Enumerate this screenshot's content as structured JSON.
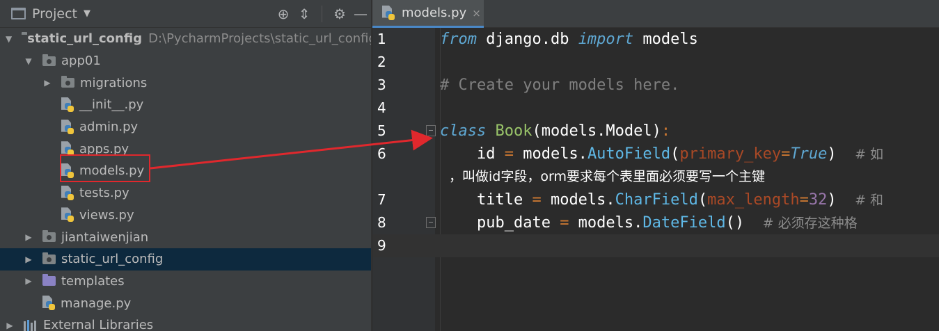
{
  "project_panel": {
    "title": "Project",
    "tree": [
      {
        "label": "static_url_config",
        "path": "D:\\PycharmProjects\\static_url_config",
        "indent": 0,
        "expanded": true,
        "type": "folder"
      },
      {
        "label": "app01",
        "indent": 1,
        "expanded": true,
        "type": "package"
      },
      {
        "label": "migrations",
        "indent": 2,
        "expanded": false,
        "type": "package"
      },
      {
        "label": "__init__.py",
        "indent": 2,
        "type": "pyfile"
      },
      {
        "label": "admin.py",
        "indent": 2,
        "type": "pyfile"
      },
      {
        "label": "apps.py",
        "indent": 2,
        "type": "pyfile"
      },
      {
        "label": "models.py",
        "indent": 2,
        "type": "pyfile",
        "highlighted": true
      },
      {
        "label": "tests.py",
        "indent": 2,
        "type": "pyfile"
      },
      {
        "label": "views.py",
        "indent": 2,
        "type": "pyfile"
      },
      {
        "label": "jiantaiwenjian",
        "indent": 1,
        "expanded": false,
        "type": "package"
      },
      {
        "label": "static_url_config",
        "indent": 1,
        "expanded": false,
        "type": "package",
        "selected": true
      },
      {
        "label": "templates",
        "indent": 1,
        "expanded": false,
        "type": "template-folder"
      },
      {
        "label": "manage.py",
        "indent": 1,
        "type": "pyfile"
      },
      {
        "label": "External Libraries",
        "indent": 0,
        "expanded": false,
        "type": "libraries"
      }
    ]
  },
  "editor": {
    "tab_label": "models.py",
    "tab_close": "×",
    "lines": [
      {
        "num": "1",
        "tokens": [
          [
            "kwi",
            "from"
          ],
          [
            "txt",
            " django.db "
          ],
          [
            "kwi",
            "import"
          ],
          [
            "txt",
            " models"
          ]
        ]
      },
      {
        "num": "2",
        "tokens": []
      },
      {
        "num": "3",
        "tokens": [
          [
            "cmt",
            "# Create your models here."
          ]
        ]
      },
      {
        "num": "4",
        "tokens": []
      },
      {
        "num": "5",
        "fold": true,
        "tokens": [
          [
            "kwi",
            "class"
          ],
          [
            "txt",
            " "
          ],
          [
            "cls",
            "Book"
          ],
          [
            "txt",
            "(models.Model)"
          ],
          [
            "kw",
            ":"
          ]
        ]
      },
      {
        "num": "6",
        "tokens": [
          [
            "txt",
            "    id "
          ],
          [
            "kw",
            "="
          ],
          [
            "txt",
            " models."
          ],
          [
            "fn",
            "AutoField"
          ],
          [
            "txt",
            "("
          ],
          [
            "param",
            "primary_key"
          ],
          [
            "kw",
            "="
          ],
          [
            "kwi",
            "True"
          ],
          [
            "txt",
            ")  "
          ],
          [
            "cmt2",
            "# 如"
          ]
        ]
      },
      {
        "num": "",
        "wrap": true,
        "tokens": [
          [
            "txt",
            "，叫做id字段，orm要求每个表里面必须要写一个主键"
          ]
        ]
      },
      {
        "num": "7",
        "tokens": [
          [
            "txt",
            "    title "
          ],
          [
            "kw",
            "="
          ],
          [
            "txt",
            " models."
          ],
          [
            "fn",
            "CharField"
          ],
          [
            "txt",
            "("
          ],
          [
            "param",
            "max_length"
          ],
          [
            "kw",
            "="
          ],
          [
            "num",
            "32"
          ],
          [
            "txt",
            ")  "
          ],
          [
            "cmt2",
            "# 和"
          ]
        ]
      },
      {
        "num": "8",
        "fold": true,
        "tokens": [
          [
            "txt",
            "    pub_date "
          ],
          [
            "kw",
            "="
          ],
          [
            "txt",
            " models."
          ],
          [
            "fn",
            "DateField"
          ],
          [
            "txt",
            "()  "
          ],
          [
            "cmt2",
            "# 必须存这种格"
          ]
        ]
      },
      {
        "num": "9",
        "current": true,
        "tokens": []
      }
    ]
  },
  "colors": {
    "panel_bg": "#3c3f41",
    "editor_bg": "#2b2b2b",
    "selection": "#0d293e",
    "annotation_red": "#e0282d"
  }
}
